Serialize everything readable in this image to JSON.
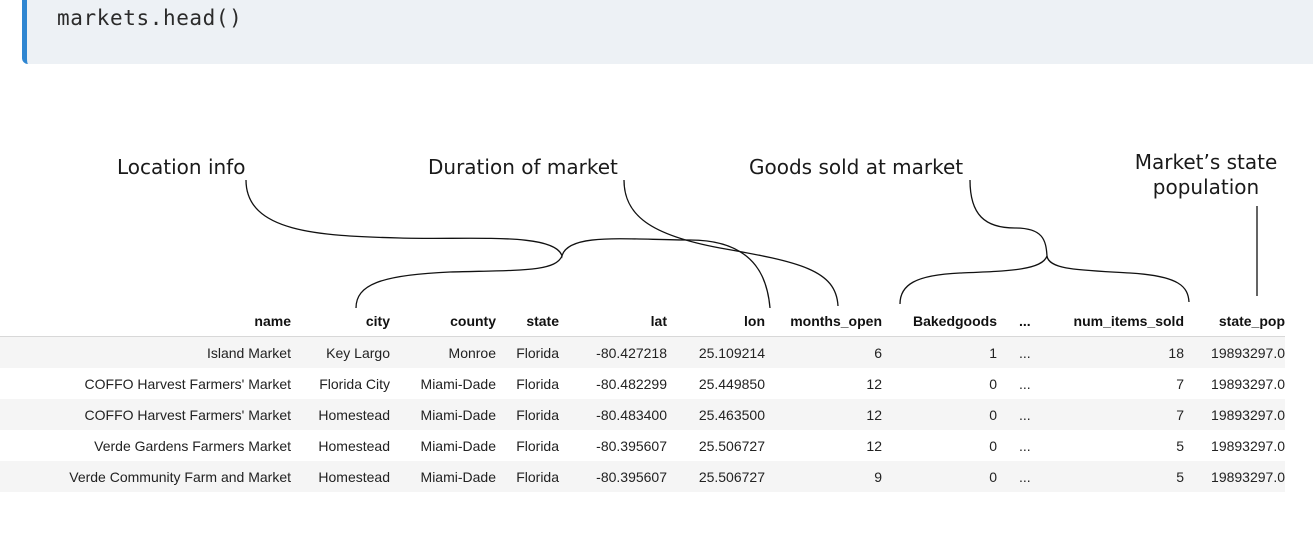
{
  "code": "markets.head()",
  "annotations": {
    "location": "Location info",
    "duration": "Duration of market",
    "goods": "Goods sold at market",
    "state_pop_line1": "Market’s state",
    "state_pop_line2": "population"
  },
  "table": {
    "headers": [
      "name",
      "city",
      "county",
      "state",
      "lat",
      "lon",
      "months_open",
      "Bakedgoods",
      "...",
      "num_items_sold",
      "state_pop"
    ],
    "rows": [
      [
        "Island Market",
        "Key Largo",
        "Monroe",
        "Florida",
        "-80.427218",
        "25.109214",
        "6",
        "1",
        "...",
        "18",
        "19893297.0"
      ],
      [
        "COFFO Harvest Farmers' Market",
        "Florida City",
        "Miami-Dade",
        "Florida",
        "-80.482299",
        "25.449850",
        "12",
        "0",
        "...",
        "7",
        "19893297.0"
      ],
      [
        "COFFO Harvest Farmers' Market",
        "Homestead",
        "Miami-Dade",
        "Florida",
        "-80.483400",
        "25.463500",
        "12",
        "0",
        "...",
        "7",
        "19893297.0"
      ],
      [
        "Verde Gardens Farmers Market",
        "Homestead",
        "Miami-Dade",
        "Florida",
        "-80.395607",
        "25.506727",
        "12",
        "0",
        "...",
        "5",
        "19893297.0"
      ],
      [
        "Verde Community Farm and Market",
        "Homestead",
        "Miami-Dade",
        "Florida",
        "-80.395607",
        "25.506727",
        "9",
        "0",
        "...",
        "5",
        "19893297.0"
      ]
    ]
  }
}
